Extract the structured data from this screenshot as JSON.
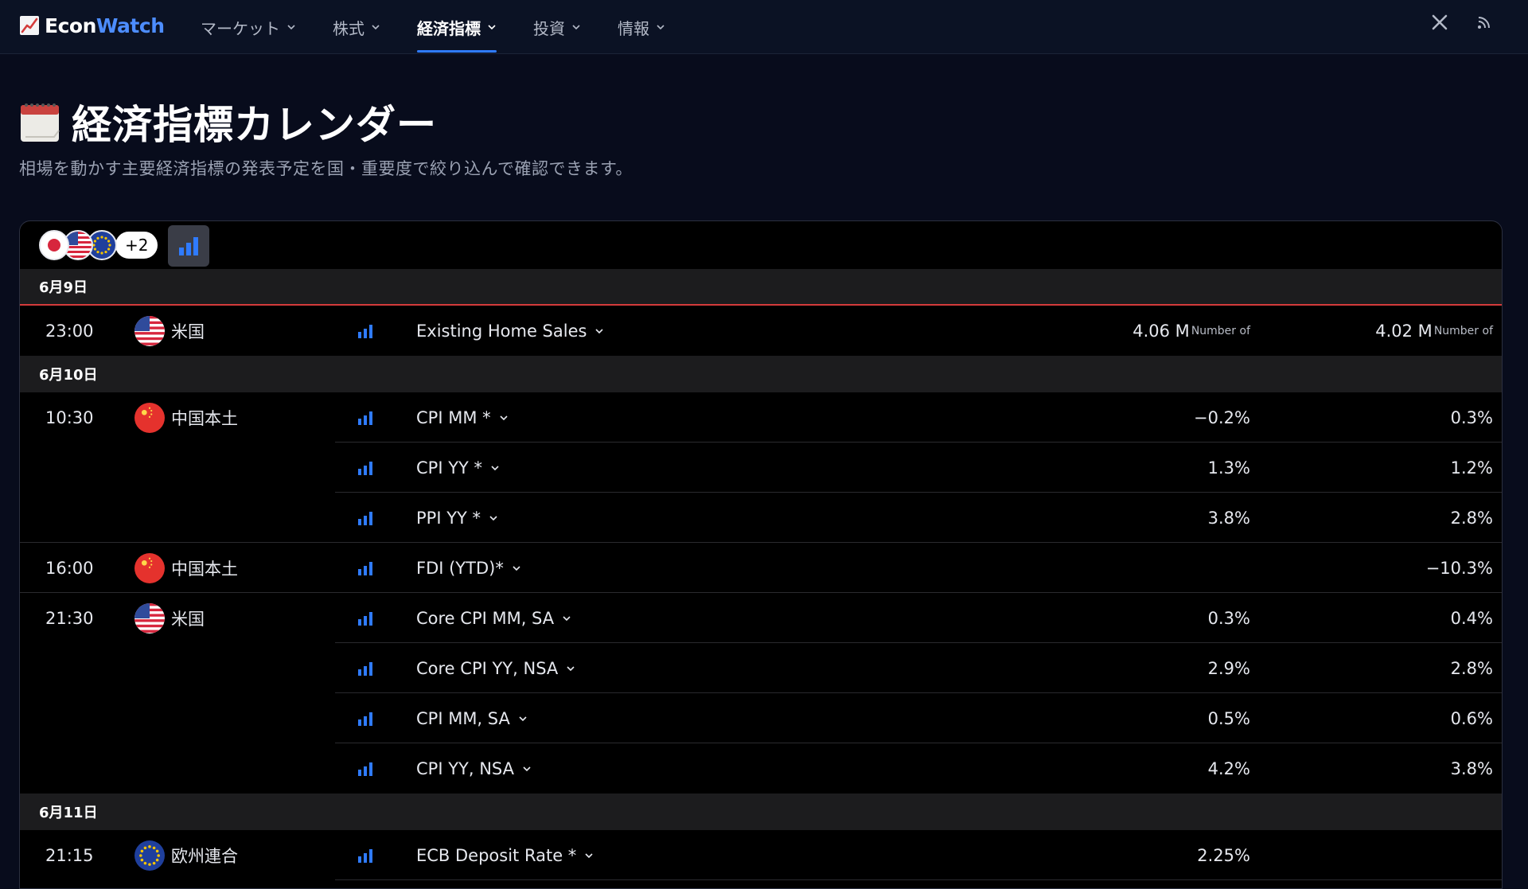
{
  "nav": {
    "brand_a": "Econ",
    "brand_b": "Watch",
    "menu": [
      {
        "label": "マーケット",
        "active": false
      },
      {
        "label": "株式",
        "active": false
      },
      {
        "label": "経済指標",
        "active": true
      },
      {
        "label": "投資",
        "active": false
      },
      {
        "label": "情報",
        "active": false
      }
    ],
    "social_icons": [
      "x-icon",
      "rss-icon"
    ]
  },
  "header": {
    "title": "経済指標カレンダー",
    "title_icon": "calendar-icon",
    "subtitle": "相場を動かす主要経済指標の発表予定を国・重要度で絞り込んで確認できます。"
  },
  "filters": {
    "flag_icons": [
      "flag-japan-icon",
      "flag-usa-icon",
      "flag-eu-icon"
    ],
    "more_label": "+2",
    "importance_icon": "importance-bars-icon"
  },
  "colors": {
    "accent": "#2f7bff",
    "date_separator": "#d33b3b",
    "background": "#080c1c"
  },
  "days": [
    {
      "date": "6月9日",
      "events": [
        {
          "time": "23:00",
          "country": "米国",
          "flag": "flag-usa-icon",
          "name": "Existing Home Sales",
          "actual": "4.06 M",
          "actual_unit": "Number of",
          "previous": "4.02 M",
          "previous_unit": "Number of"
        }
      ]
    },
    {
      "date": "6月10日",
      "events": [
        {
          "time": "10:30",
          "country": "中国本土",
          "flag": "flag-china-icon",
          "name": "CPI MM *",
          "actual": "−0.2%",
          "previous": "0.3%"
        },
        {
          "time": "",
          "country": "",
          "flag": "",
          "name": "CPI YY *",
          "actual": "1.3%",
          "previous": "1.2%"
        },
        {
          "time": "",
          "country": "",
          "flag": "",
          "name": "PPI YY *",
          "actual": "3.8%",
          "previous": "2.8%"
        },
        {
          "time": "16:00",
          "country": "中国本土",
          "flag": "flag-china-icon",
          "name": "FDI (YTD)*",
          "actual": "",
          "previous": "−10.3%"
        },
        {
          "time": "21:30",
          "country": "米国",
          "flag": "flag-usa-icon",
          "name": "Core CPI MM, SA",
          "actual": "0.3%",
          "previous": "0.4%"
        },
        {
          "time": "",
          "country": "",
          "flag": "",
          "name": "Core CPI YY, NSA",
          "actual": "2.9%",
          "previous": "2.8%"
        },
        {
          "time": "",
          "country": "",
          "flag": "",
          "name": "CPI MM, SA",
          "actual": "0.5%",
          "previous": "0.6%"
        },
        {
          "time": "",
          "country": "",
          "flag": "",
          "name": "CPI YY, NSA",
          "actual": "4.2%",
          "previous": "3.8%"
        }
      ]
    },
    {
      "date": "6月11日",
      "events": [
        {
          "time": "21:15",
          "country": "欧州連合",
          "flag": "flag-eu-icon",
          "name": "ECB Deposit Rate *",
          "actual": "2.25%",
          "previous": ""
        }
      ]
    }
  ]
}
